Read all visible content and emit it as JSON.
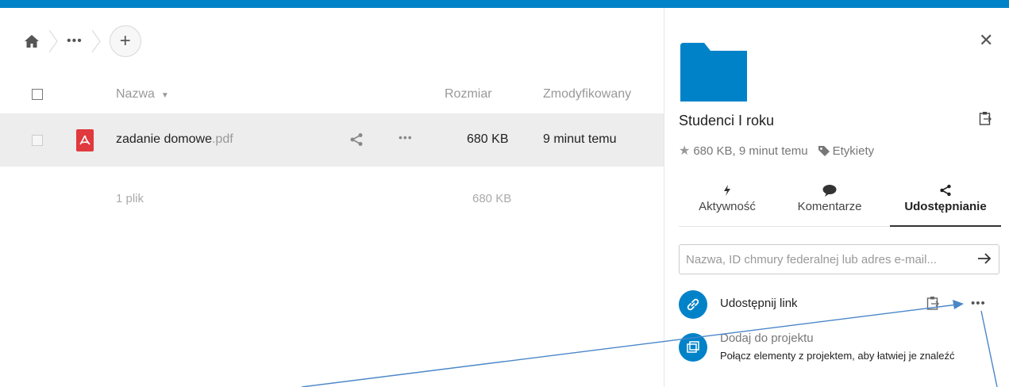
{
  "breadcrumb": {
    "more": "•••",
    "add": "+"
  },
  "table": {
    "header": {
      "name": "Nazwa",
      "size": "Rozmiar",
      "modified": "Zmodyfikowany"
    },
    "rows": [
      {
        "name_base": "zadanie domowe",
        "name_ext": ".pdf",
        "more": "•••",
        "size": "680 KB",
        "modified": "9 minut temu"
      }
    ],
    "summary": {
      "count": "1 plik",
      "size": "680 KB"
    }
  },
  "sidebar": {
    "close": "✕",
    "title": "Studenci I roku",
    "meta": {
      "info": "680 KB, 9 minut temu",
      "tags": "Etykiety"
    },
    "tabs": [
      {
        "label": "Aktywność"
      },
      {
        "label": "Komentarze"
      },
      {
        "label": "Udostępnianie"
      }
    ],
    "share": {
      "placeholder": "Nazwa, ID chmury federalnej lub adres e-mail...",
      "link_label": "Udostępnij link",
      "more": "•••",
      "project_title": "Dodaj do projektu",
      "project_desc": "Połącz elementy z projektem, aby łatwiej je znaleźć"
    }
  },
  "colors": {
    "accent": "#0082c9",
    "pdf": "#e0393e",
    "annotation": "#4a86c8"
  }
}
